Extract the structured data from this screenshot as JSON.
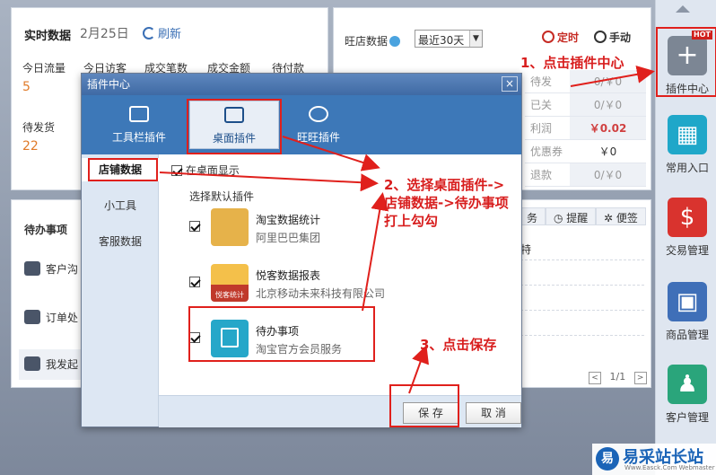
{
  "realtime": {
    "title": "实时数据",
    "date": "2月25日",
    "refresh": "刷新",
    "stats": [
      {
        "label": "今日流量",
        "value": "5"
      },
      {
        "label": "今日访客",
        "value": ""
      },
      {
        "label": "成交笔数",
        "value": ""
      },
      {
        "label": "成交金额",
        "value": ""
      },
      {
        "label": "待付款",
        "value": ""
      }
    ],
    "pending_ship": {
      "label": "待发货",
      "value": "22"
    }
  },
  "wang": {
    "label": "旺店数据",
    "range": "最近30天",
    "timer": "定时",
    "manual": "手动",
    "rows": [
      {
        "label": "待发",
        "value": "0/￥0"
      },
      {
        "label": "已关",
        "value": "0/￥0"
      },
      {
        "label": "利润",
        "value": "￥0.02"
      },
      {
        "label": "优惠券",
        "value": "￥0"
      },
      {
        "label": "退款",
        "value": "0/￥0"
      }
    ]
  },
  "todo": {
    "title": "待办事项",
    "items": [
      "客户沟",
      "订单处",
      "我发起"
    ]
  },
  "notes": {
    "tabs": [
      "务",
      "提醒",
      "便签"
    ],
    "first_line": "特",
    "pager": "1/1"
  },
  "sidebar": {
    "items": [
      {
        "label": "插件中心",
        "badge": "HOT",
        "color": "#7c8694"
      },
      {
        "label": "常用入口",
        "color": "#1fa7c9"
      },
      {
        "label": "交易管理",
        "color": "#d9332e"
      },
      {
        "label": "商品管理",
        "color": "#3f6fb8"
      },
      {
        "label": "客户管理",
        "color": "#2aa57b"
      }
    ]
  },
  "modal": {
    "title": "插件中心",
    "close": "×",
    "tabs": [
      "工具栏插件",
      "桌面插件",
      "旺旺插件"
    ],
    "nav": [
      "店铺数据",
      "小工具",
      "客服数据"
    ],
    "show_on_desktop": "在桌面显示",
    "choose_default": "选择默认插件",
    "plugins": [
      {
        "name": "淘宝数据统计",
        "vendor": "阿里巴巴集团"
      },
      {
        "name": "悦客数据报表",
        "vendor": "北京移动未来科技有限公司",
        "icon_text": "悦客统计"
      },
      {
        "name": "待办事项",
        "vendor": "淘宝官方会员服务"
      }
    ],
    "save": "保 存",
    "cancel": "取 消"
  },
  "annotations": {
    "step1": "1、点击插件中心",
    "step2_l1": "2、选择桌面插件->",
    "step2_l2": "店铺数据->待办事项",
    "step2_l3": "打上勾勾",
    "step3": "3、点击保存"
  },
  "watermark": {
    "logo": "易",
    "text": "易采站长站",
    "sub": "Www.Easck.Com Webmaster"
  }
}
